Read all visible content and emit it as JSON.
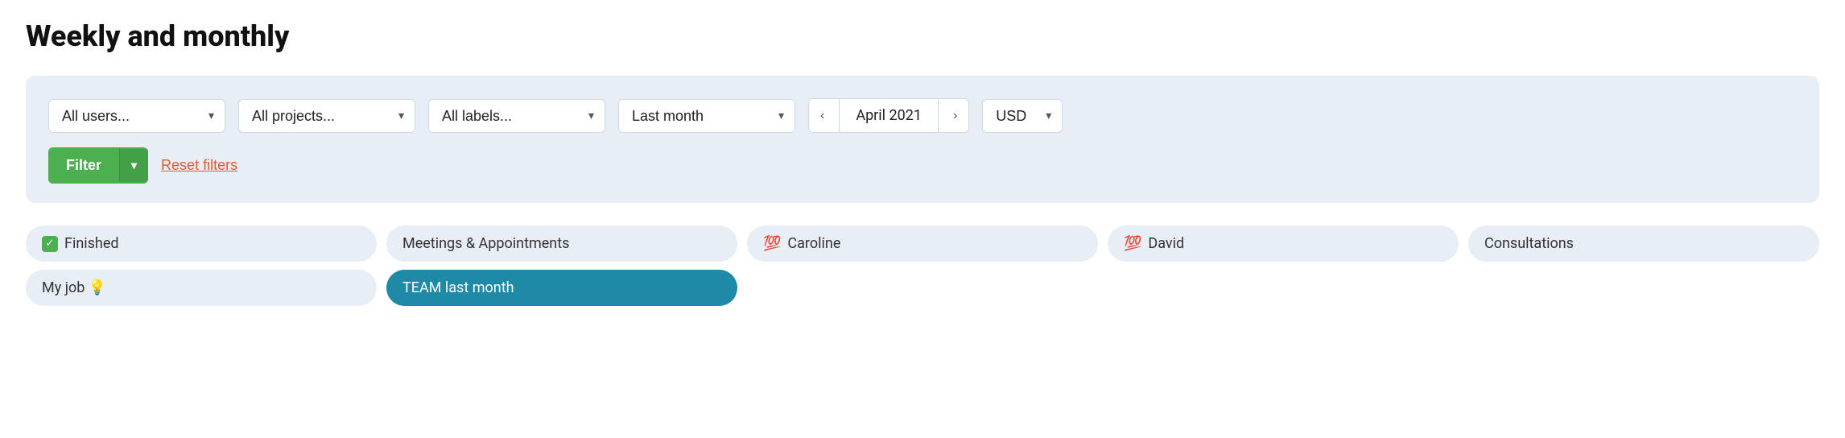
{
  "page": {
    "title": "Weekly and monthly"
  },
  "filters": {
    "users_label": "All users...",
    "projects_label": "All projects...",
    "labels_label": "All labels...",
    "period_label": "Last month",
    "date_label": "April 2021",
    "currency_label": "USD",
    "filter_btn": "Filter",
    "filter_btn_arrow": "▾",
    "reset_label": "Reset filters",
    "nav_prev": "‹",
    "nav_next": "›"
  },
  "tags": [
    {
      "id": "finished",
      "label": "Finished",
      "type": "checkbox",
      "checked": true,
      "row": 0,
      "col": 0
    },
    {
      "id": "meetings",
      "label": "Meetings & Appointments",
      "type": "normal",
      "checked": false,
      "row": 0,
      "col": 1
    },
    {
      "id": "caroline",
      "label": "Caroline",
      "type": "emoji",
      "emoji": "💯",
      "checked": false,
      "row": 0,
      "col": 2
    },
    {
      "id": "david",
      "label": "David",
      "type": "emoji",
      "emoji": "💯",
      "checked": false,
      "row": 0,
      "col": 3
    },
    {
      "id": "consultations",
      "label": "Consultations",
      "type": "normal",
      "checked": false,
      "row": 0,
      "col": 4
    },
    {
      "id": "myjob",
      "label": "My job 💡",
      "type": "normal",
      "checked": false,
      "row": 1,
      "col": 0
    },
    {
      "id": "team",
      "label": "TEAM last month",
      "type": "active",
      "checked": false,
      "row": 1,
      "col": 1
    }
  ],
  "colors": {
    "filter_bar_bg": "#e8eef5",
    "tag_bg": "#e8eef5",
    "tag_active": "#1e8aa8",
    "filter_btn": "#4caf50",
    "reset_color": "#e05c2a"
  }
}
